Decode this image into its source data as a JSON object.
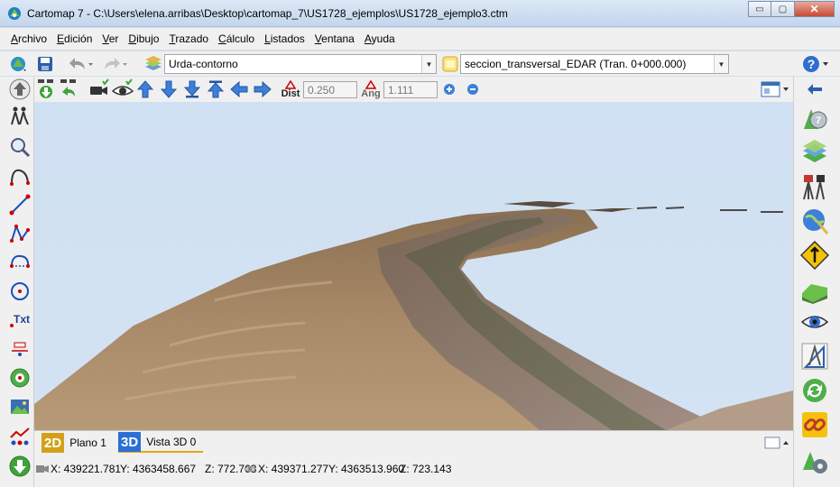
{
  "window": {
    "title": "Cartomap 7 - C:\\Users\\elena.arribas\\Desktop\\cartomap_7\\US1728_ejemplos\\US1728_ejemplo3.ctm",
    "minimize_label": "▭",
    "maximize_label": "▢",
    "close_label": "✕"
  },
  "menu": [
    "Archivo",
    "Edición",
    "Ver",
    "Dibujo",
    "Trazado",
    "Cálculo",
    "Listados",
    "Ventana",
    "Ayuda"
  ],
  "toolbar": {
    "layer_combo": "Urda-contorno",
    "section_combo": "seccion_transversal_EDAR (Tran. 0+000.000)"
  },
  "view_toolbar": {
    "dist_label": "Dist",
    "dist_value": "0.250",
    "ang_label": "Ang",
    "ang_value": "1.111"
  },
  "left_tools": {
    "text_tool_label": "Txt"
  },
  "tabs": [
    {
      "badge": "2D",
      "label": "Plano 1",
      "active": false,
      "color": "#d4a017"
    },
    {
      "badge": "3D",
      "label": "Vista 3D 0",
      "active": true,
      "color": "#2b6fd6"
    }
  ],
  "status": {
    "camera_x": "X: 439221.781",
    "camera_y": "Y: 4363458.667",
    "camera_z": "Z: 772.763",
    "target_x": "X: 439371.277",
    "target_y": "Y: 4363513.960",
    "target_z": "Z: 723.143"
  },
  "colors": {
    "sky": "#cfe0f2",
    "terrain": "#9c7b58",
    "road": "#6b6b55",
    "accent_tab": "#e8a317"
  }
}
